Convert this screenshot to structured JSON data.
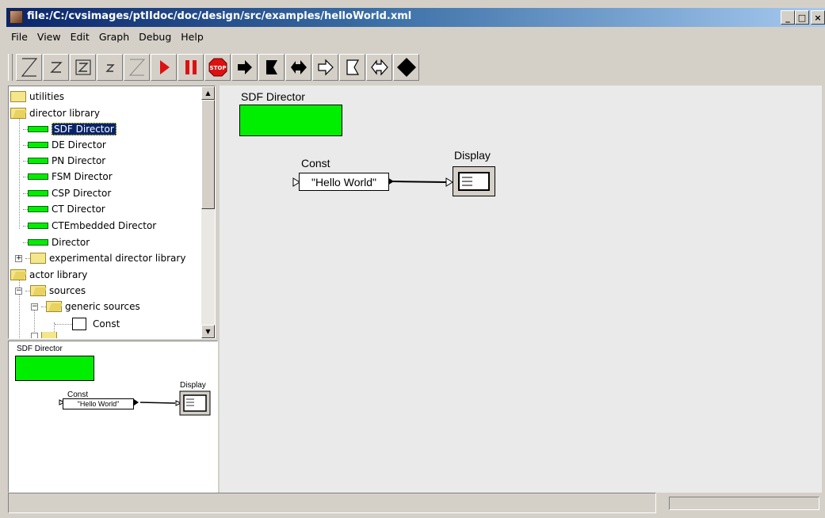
{
  "window": {
    "title": "file:/C:/cvsimages/ptIIdoc/doc/design/src/examples/helloWorld.xml",
    "minimize": "_",
    "maximize": "□",
    "close": "×"
  },
  "menu": {
    "file": "File",
    "view": "View",
    "edit": "Edit",
    "graph": "Graph",
    "debug": "Debug",
    "help": "Help"
  },
  "toolbar": {
    "buttons": [
      "zoom-in-icon",
      "zoom-reset-icon",
      "zoom-fit-icon",
      "zoom-out-icon",
      "zoom-icon",
      "run-icon",
      "pause-icon",
      "stop-icon",
      "arrow-right-icon",
      "flag-icon",
      "double-arrow-icon",
      "outline-arrow-icon",
      "outline-flag-icon",
      "outline-double-arrow-icon",
      "diamond-icon"
    ],
    "stop_label": "STOP"
  },
  "tree": {
    "utilities": "utilities",
    "director_library": "director library",
    "sdf_director": "SDF Director",
    "de_director": "DE Director",
    "pn_director": "PN Director",
    "fsm_director": "FSM Director",
    "csp_director": "CSP Director",
    "ct_director": "CT Director",
    "ctembedded_director": "CTEmbedded Director",
    "director": "Director",
    "experimental_director_library": "experimental director library",
    "actor_library": "actor library",
    "sources": "sources",
    "generic_sources": "generic sources",
    "const": "Const",
    "plus": "+",
    "minus": "−"
  },
  "overview": {
    "director_label": "SDF Director",
    "const_label": "Const",
    "const_value": "\"Hello World\"",
    "display_label": "Display"
  },
  "canvas": {
    "director_label": "SDF Director",
    "const_label": "Const",
    "const_value": "\"Hello World\"",
    "display_label": "Display"
  },
  "colors": {
    "director_green": "#00ee00",
    "run_red": "#dd1111",
    "title_blue": "#0a246a",
    "selection": "#0a246a"
  }
}
